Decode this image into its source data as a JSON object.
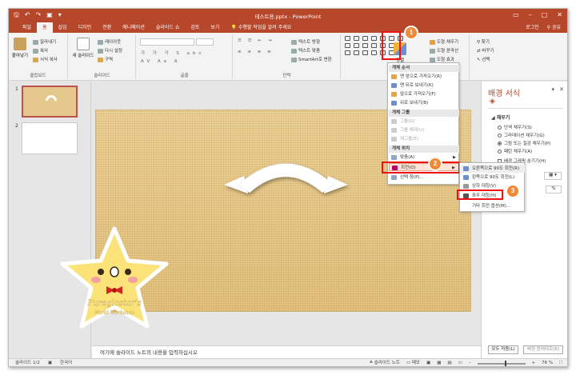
{
  "app": {
    "title": "테스트용.pptx - PowerPoint"
  },
  "tabs": [
    "파일",
    "홈",
    "삽입",
    "디자인",
    "전환",
    "애니메이션",
    "슬라이드 쇼",
    "검토",
    "보기"
  ],
  "active_tab_index": 1,
  "tell_me": "수행할 작업을 알려 주세요",
  "account": {
    "login": "로그인",
    "share": "공유"
  },
  "ribbon": {
    "clipboard": {
      "label": "클립보드",
      "paste": "붙여넣기",
      "cut": "잘라내기",
      "copy": "복사",
      "format_painter": "서식 복사"
    },
    "slides": {
      "label": "슬라이드",
      "new_slide": "새 슬라이드",
      "layout": "레이아웃",
      "reset": "다시 설정",
      "section": "구역"
    },
    "font": {
      "label": "글꼴"
    },
    "paragraph": {
      "label": "단락",
      "text_direction": "텍스트 방향",
      "align_text": "텍스트 맞춤",
      "smartart": "SmartArt로 변환"
    },
    "drawing": {
      "arrange": "정렬",
      "shape_fill": "도형 채우기",
      "shape_outline": "도형 윤곽선",
      "shape_effects": "도형 효과"
    },
    "editing": {
      "find": "찾기",
      "replace": "바꾸기",
      "select": "선택"
    }
  },
  "arrange_menu": {
    "head_order": "개체 순서",
    "bring_front": "맨 앞으로 가져오기(R)",
    "send_back": "맨 뒤로 보내기(K)",
    "bring_forward": "앞으로 가져오기(F)",
    "send_backward": "뒤로 보내기(B)",
    "head_group": "개체 그룹",
    "group": "그룹(G)",
    "ungroup": "그룹 해제(U)",
    "regroup": "재그룹(E)",
    "head_position": "개체 위치",
    "align": "맞춤(A)",
    "rotate": "회전(O)",
    "selection_pane": "선택 창(P)..."
  },
  "rotate_menu": {
    "right90": "오른쪽으로 90도 회전(R)",
    "left90": "왼쪽으로 90도 회전(L)",
    "flip_vertical": "상하 대칭(V)",
    "flip_horizontal": "좌우 대칭(H)",
    "more": "기타 회전 옵션(M)..."
  },
  "steps": [
    "1",
    "2",
    "3"
  ],
  "slides": [
    {
      "number": "1"
    },
    {
      "number": "2"
    }
  ],
  "notes_placeholder": "여기에 슬라이드 노트의 내용을 입력하십시오",
  "format_pane": {
    "title": "배경 서식",
    "fill_section": "채우기",
    "options": [
      "단색 채우기(S)",
      "그라데이션 채우기(G)",
      "그림 또는 질감 채우기(P)",
      "패턴 채우기(A)"
    ],
    "selected_option": 2,
    "hide_bg": "배경 그래픽 숨기기(H)",
    "apply_all": "모두 적용(L)",
    "reset_bg": "배경 원래대로(B)"
  },
  "statusbar": {
    "slide_info": "슬라이드 1/2",
    "language": "한국어",
    "notes": "슬라이드 노트",
    "comments": "메모",
    "zoom": "76 %"
  },
  "mascot": {
    "line1": "Pureglostar's",
    "line2": "World Workshop"
  },
  "colors": {
    "accent": "#b7472a",
    "highlight": "#e11111",
    "badge": "#f08a36"
  }
}
